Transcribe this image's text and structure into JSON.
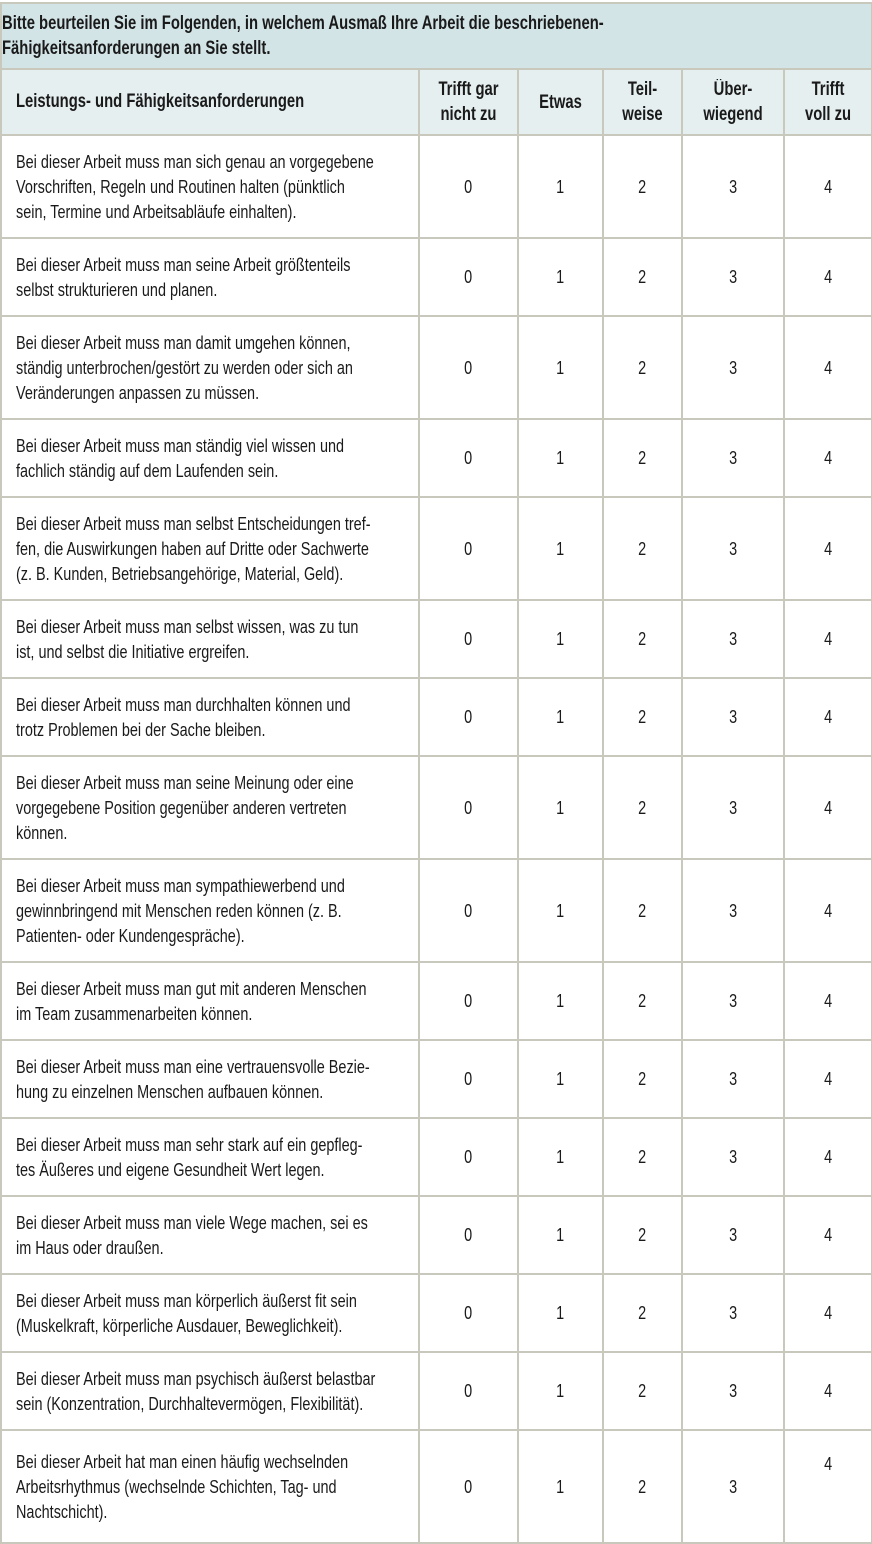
{
  "title_lines": [
    "Bitte beurteilen Sie im Folgenden, in welchem Ausmaß Ihre Arbeit die beschriebenen-",
    "Fähigkeitsanforderungen an Sie stellt."
  ],
  "header": {
    "question_col": "Leistungs- und Fähigkeitsanforderungen",
    "options": [
      {
        "lines": [
          "Trifft gar",
          "nicht zu"
        ]
      },
      {
        "lines": [
          "Etwas"
        ]
      },
      {
        "lines": [
          "Teil-",
          "weise"
        ]
      },
      {
        "lines": [
          "Über-",
          "wiegend"
        ]
      },
      {
        "lines": [
          "Trifft",
          "voll zu"
        ]
      }
    ]
  },
  "scale_values": [
    "0",
    "1",
    "2",
    "3",
    "4"
  ],
  "rows": [
    {
      "lines": [
        "Bei dieser Arbeit muss man sich genau an vorgegebene",
        "Vorschriften, Regeln und Routinen halten (pünktlich",
        "sein, Termine und Arbeitsabläufe einhalten)."
      ]
    },
    {
      "lines": [
        "Bei dieser Arbeit muss man seine Arbeit größtenteils",
        "selbst strukturieren und planen."
      ]
    },
    {
      "lines": [
        "Bei dieser Arbeit muss man damit umgehen können,",
        "ständig unterbrochen/gestört zu werden oder sich an",
        "Veränderungen anpassen zu müssen."
      ]
    },
    {
      "lines": [
        "Bei dieser Arbeit muss man ständig viel wissen und",
        "fachlich ständig auf dem Laufenden sein."
      ]
    },
    {
      "lines": [
        "Bei dieser Arbeit muss man selbst Entscheidungen tref-",
        "fen, die Auswirkungen haben auf Dritte oder Sachwerte",
        "(z. B. Kunden, Betriebsangehörige, Material, Geld)."
      ]
    },
    {
      "lines": [
        "Bei dieser Arbeit muss man selbst wissen, was zu tun",
        "ist, und selbst die Initiative ergreifen."
      ]
    },
    {
      "lines": [
        "Bei dieser Arbeit muss man durchhalten können und",
        "trotz Problemen bei der Sache bleiben."
      ]
    },
    {
      "lines": [
        "Bei dieser Arbeit muss man seine Meinung oder eine",
        "vorgegebene Position gegenüber anderen vertreten",
        "können."
      ]
    },
    {
      "lines": [
        "Bei dieser Arbeit muss man sympathiewerbend und",
        "gewinnbringend mit Menschen reden können (z. B.",
        "Patienten- oder Kundengespräche)."
      ]
    },
    {
      "lines": [
        "Bei dieser Arbeit muss man gut mit anderen Menschen",
        "im Team zusammenarbeiten können."
      ]
    },
    {
      "lines": [
        "Bei dieser Arbeit muss man eine vertrauensvolle Bezie-",
        "hung zu einzelnen Menschen aufbauen können."
      ]
    },
    {
      "lines": [
        "Bei dieser Arbeit muss man sehr stark auf ein gepfleg-",
        "tes Äußeres und eigene Gesundheit Wert legen."
      ]
    },
    {
      "lines": [
        "Bei dieser Arbeit muss man viele Wege machen, sei es",
        "im Haus oder draußen."
      ]
    },
    {
      "lines": [
        "Bei dieser Arbeit muss man körperlich äußerst fit sein",
        "(Muskelkraft, körperliche Ausdauer, Beweglichkeit)."
      ]
    },
    {
      "lines": [
        "Bei dieser Arbeit muss man psychisch äußerst belastbar",
        "sein (Konzentration, Durchhaltevermögen, Flexibilität)."
      ]
    },
    {
      "lines": [
        "Bei dieser Arbeit hat man einen häufig wechselnden",
        "Arbeitsrhythmus (wechselnde Schichten, Tag- und",
        "Nachtschicht)."
      ],
      "last_value_top": true
    }
  ],
  "colors": {
    "title_bg": "#d3e4e7",
    "header_bg": "#e5eff0",
    "border": "#c9c8bd"
  }
}
